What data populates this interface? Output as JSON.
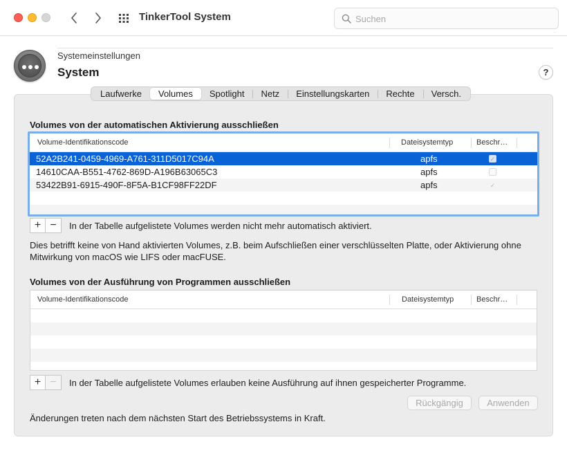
{
  "window": {
    "title": "TinkerTool System",
    "search_placeholder": "Suchen"
  },
  "header": {
    "breadcrumb": "Systemeinstellungen",
    "title": "System",
    "help_label": "?"
  },
  "tabs": [
    {
      "label": "Laufwerke",
      "active": false
    },
    {
      "label": "Volumes",
      "active": true
    },
    {
      "label": "Spotlight",
      "active": false
    },
    {
      "label": "Netz",
      "active": false
    },
    {
      "label": "Einstellungskarten",
      "active": false
    },
    {
      "label": "Rechte",
      "active": false
    },
    {
      "label": "Versch.",
      "active": false
    }
  ],
  "section1": {
    "title": "Volumes von der automatischen Aktivierung ausschließen",
    "columns": {
      "id": "Volume-Identifikationscode",
      "fs": "Dateisystemtyp",
      "flag": "Beschr…"
    },
    "rows": [
      {
        "id": "52A2B241-0459-4969-A761-311D5017C94A",
        "fs": "apfs",
        "checked": true,
        "selected": true
      },
      {
        "id": "14610CAA-B551-4762-869D-A196B63065C3",
        "fs": "apfs",
        "checked": false,
        "selected": false
      },
      {
        "id": "53422B91-6915-490F-8F5A-B1CF98FF22DF",
        "fs": "apfs",
        "checked": true,
        "selected": false
      }
    ],
    "plus": "+",
    "minus": "−",
    "note": "In der Tabelle aufgelistete Volumes werden nicht mehr automatisch aktiviert.",
    "description": "Dies betrifft keine von Hand aktivierten Volumes, z.B. beim Aufschließen einer verschlüsselten Platte, oder Aktivierung ohne Mitwirkung von macOS wie LIFS oder macFUSE."
  },
  "section2": {
    "title": "Volumes von der Ausführung von Programmen ausschließen",
    "columns": {
      "id": "Volume-Identifikationscode",
      "fs": "Dateisystemtyp",
      "flag": "Beschr…"
    },
    "plus": "+",
    "minus": "−",
    "note": "In der Tabelle aufgelistete Volumes erlauben keine Ausführung auf ihnen gespeicherter Programme."
  },
  "buttons": {
    "revert": "Rückgängig",
    "apply": "Anwenden"
  },
  "footer": "Änderungen treten nach dem nächsten Start des Betriebssystems in Kraft.",
  "check_glyph": "✓"
}
